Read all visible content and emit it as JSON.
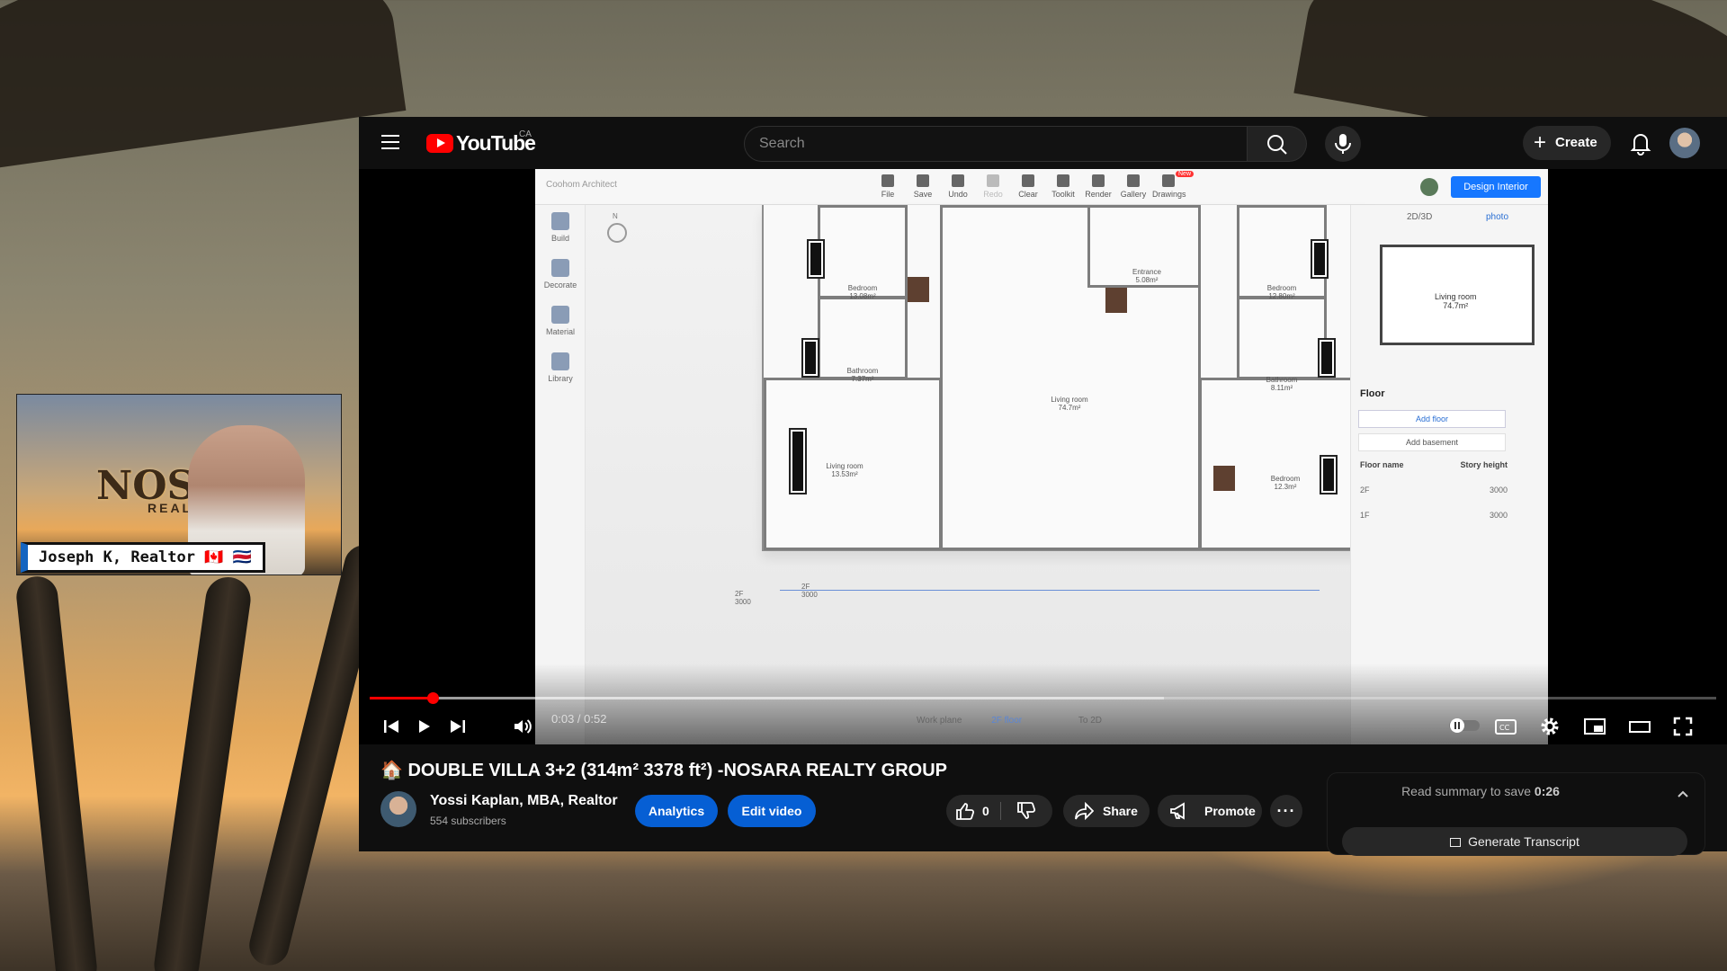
{
  "overlay": {
    "presenter_name": "Joseph K, Realtor 🇨🇦 🇨🇷",
    "logo_text": "NOSARA",
    "logo_subtext": "REALTY GR"
  },
  "header": {
    "brand": "YouTube",
    "country": "CA",
    "search_placeholder": "Search",
    "create_label": "Create"
  },
  "app": {
    "title": "Coohom Architect",
    "tools": [
      "File",
      "Save",
      "Undo",
      "Redo",
      "Clear",
      "Toolkit",
      "Render",
      "Gallery",
      "Drawings"
    ],
    "tool_badge": "New",
    "design_button": "Design Interior",
    "rail": [
      "Build",
      "Decorate",
      "Material",
      "Library"
    ],
    "compass": "N",
    "rooms": [
      {
        "name": "Bedroom",
        "area": "13.08m²"
      },
      {
        "name": "Bathroom",
        "area": "7.37m²"
      },
      {
        "name": "Living room",
        "area": "13.53m²"
      },
      {
        "name": "Living room",
        "area": "74.7m²"
      },
      {
        "name": "Entrance",
        "area": "5.08m²"
      },
      {
        "name": "Bedroom",
        "area": "12.80m²"
      },
      {
        "name": "Bathroom",
        "area": "8.11m²"
      },
      {
        "name": "Bedroom",
        "area": "12.3m²"
      }
    ],
    "floor_tags": [
      "2F",
      "3000",
      "2F",
      "3000"
    ],
    "panel": {
      "tabs": [
        "2D/3D",
        "photo"
      ],
      "minimap_label": "Living room",
      "minimap_area": "74.7m²",
      "floor_title": "Floor",
      "add_floor": "Add floor",
      "add_basement": "Add basement",
      "col_name": "Floor name",
      "col_height": "Story height",
      "floors": [
        {
          "name": "2F",
          "height": "3000"
        },
        {
          "name": "1F",
          "height": "3000"
        }
      ]
    },
    "bottom": {
      "work_plane": "Work plane",
      "floor": "2F floor",
      "to2d": "To 2D"
    }
  },
  "player": {
    "time": "0:03 / 0:52",
    "progress_fraction": 0.047,
    "loaded_fraction": 0.59
  },
  "video_info": {
    "title": "🏠 DOUBLE VILLA 3+2 (314m² 3378 ft²) -NOSARA REALTY GROUP",
    "channel": "Yossi Kaplan, MBA, Realtor",
    "subscribers": "554 subscribers",
    "analytics": "Analytics",
    "edit_video": "Edit video",
    "likes": "0",
    "share": "Share",
    "promote": "Promote"
  },
  "summary": {
    "text": "Read summary to save",
    "time_saved": "0:26",
    "generate": "Generate Transcript"
  }
}
